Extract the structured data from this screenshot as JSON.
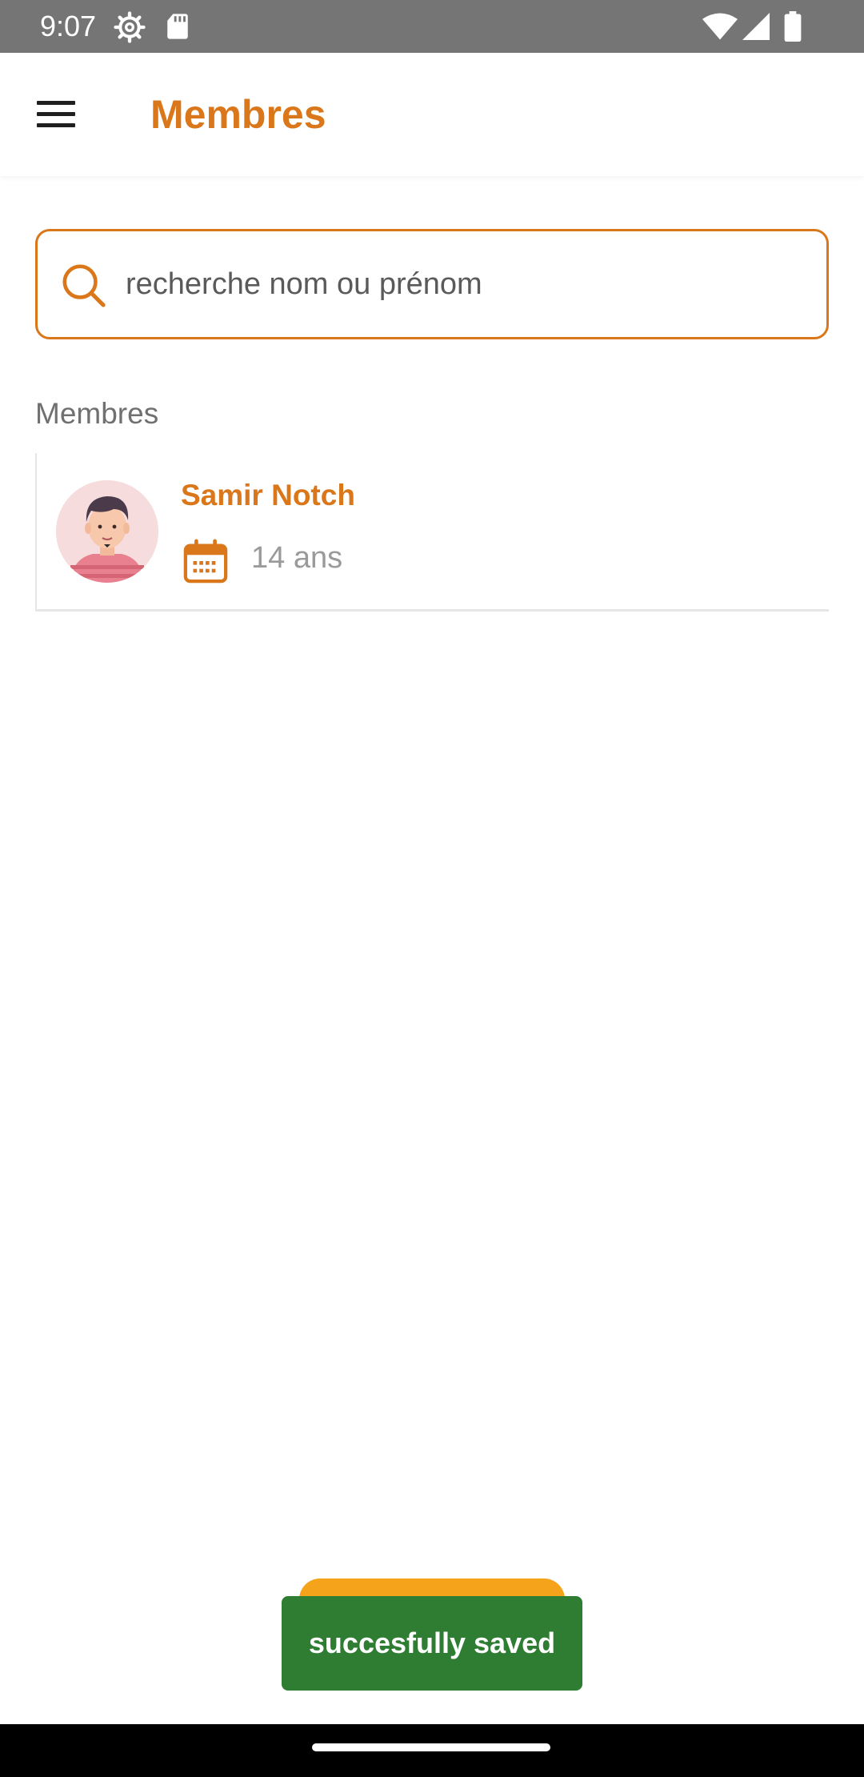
{
  "status_bar": {
    "time": "9:07",
    "icons": [
      "settings-gear-icon",
      "sd-card-icon",
      "wifi-icon",
      "signal-icon",
      "battery-icon"
    ]
  },
  "app_bar": {
    "title": "Membres",
    "menu_icon": "hamburger-menu-icon"
  },
  "search": {
    "placeholder": "recherche nom ou prénom",
    "value": "",
    "icon": "search-icon"
  },
  "members_section": {
    "label": "Membres",
    "items": [
      {
        "name": "Samir Notch",
        "age": "14 ans",
        "avatar": "boy-avatar",
        "age_icon": "calendar-icon"
      }
    ]
  },
  "toast": {
    "message": "succesfully saved"
  },
  "colors": {
    "accent": "#D9771A",
    "button": "#F5A31A",
    "toast_bg": "#2E7D32",
    "status_bar": "#757575"
  }
}
